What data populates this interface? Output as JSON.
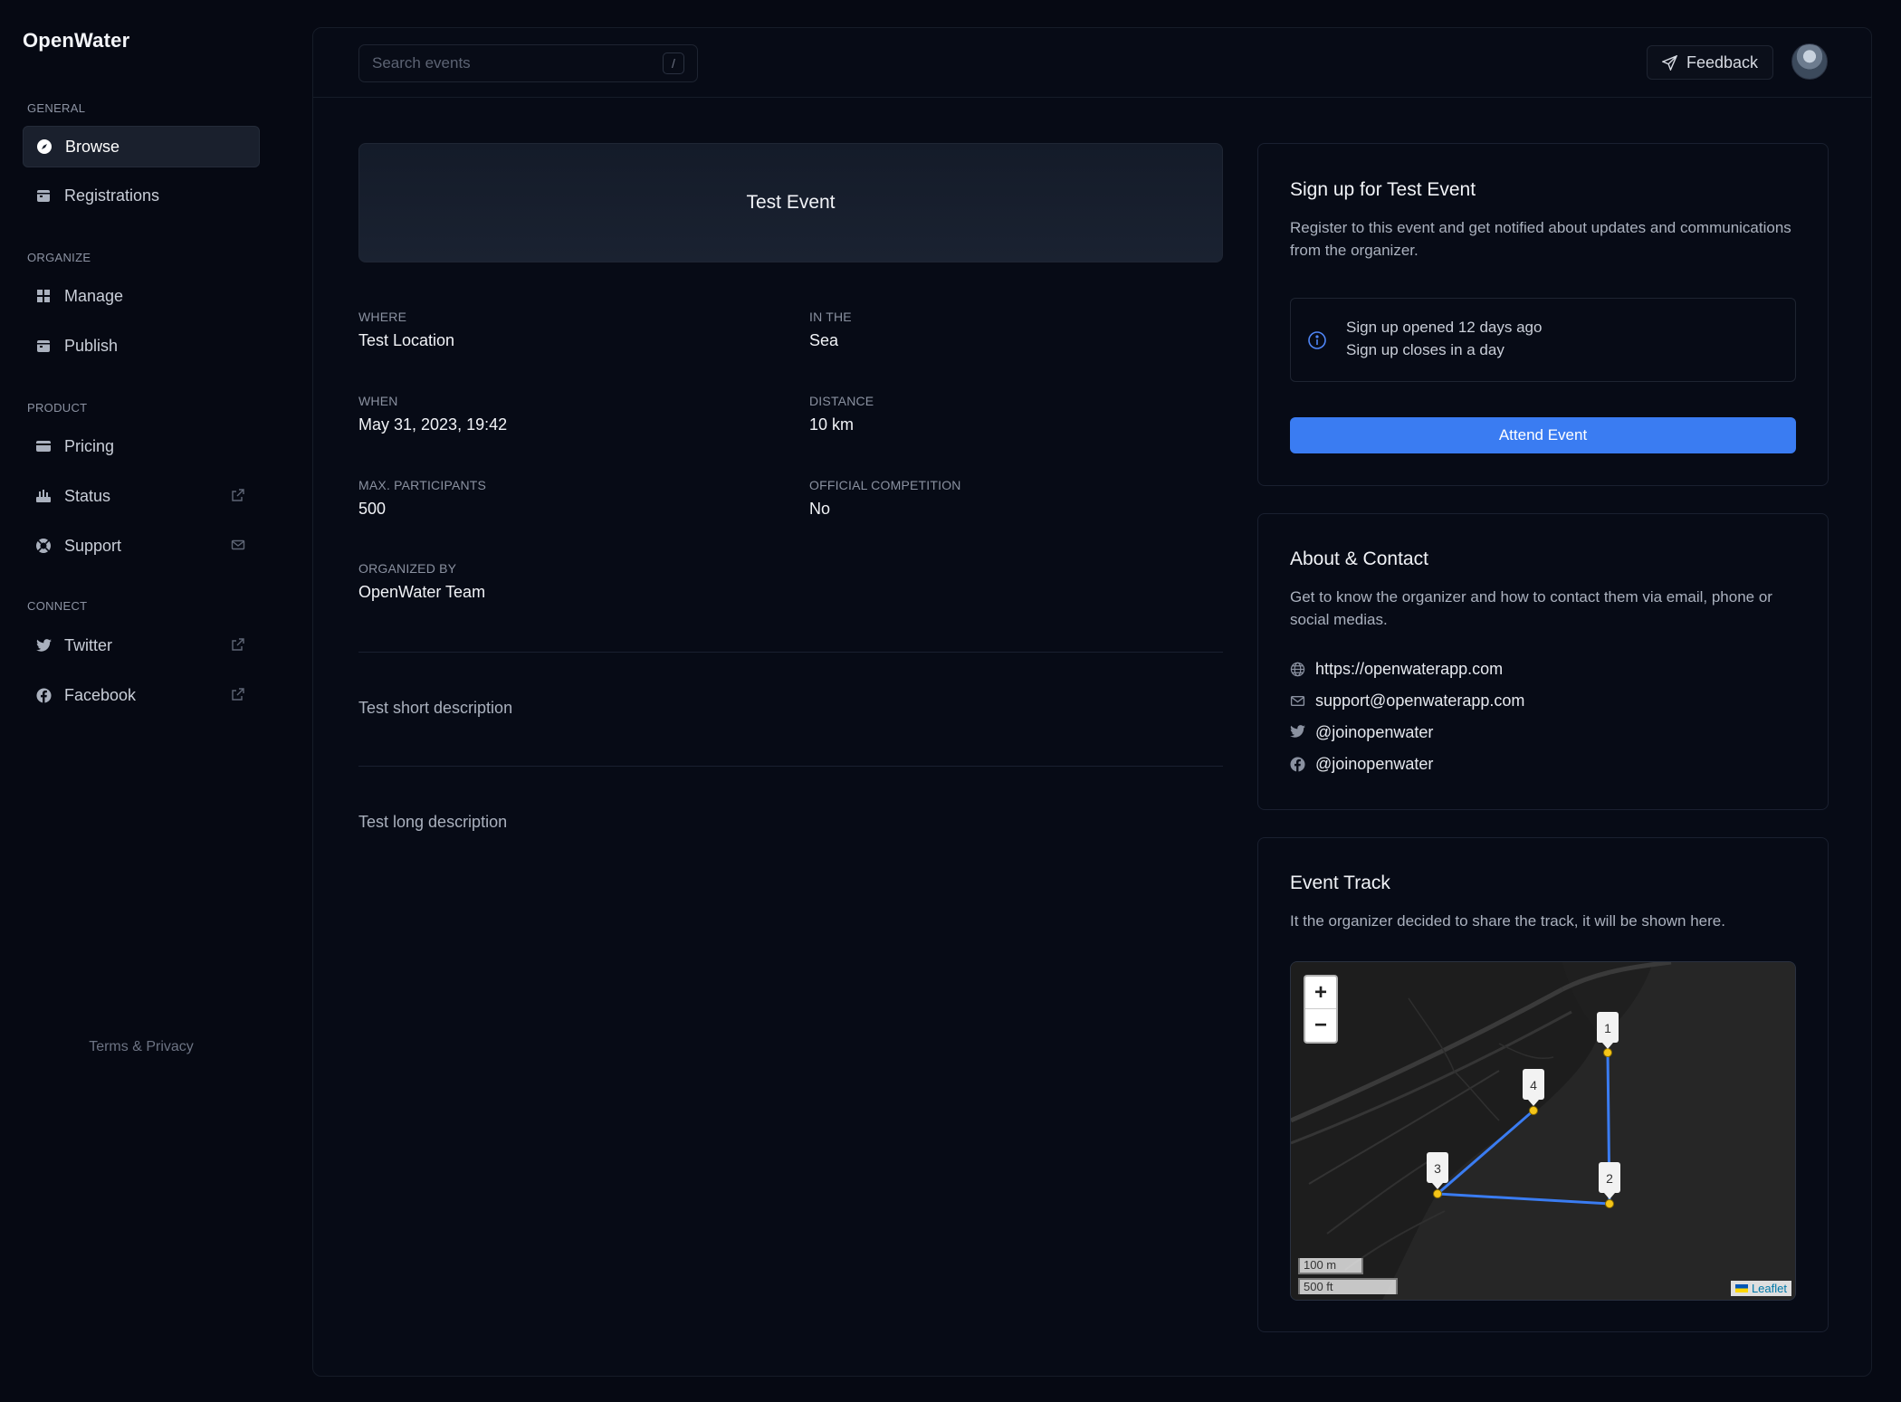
{
  "app": {
    "name": "OpenWater"
  },
  "sidebar": {
    "sections": [
      {
        "label": "GENERAL"
      },
      {
        "label": "ORGANIZE"
      },
      {
        "label": "PRODUCT"
      },
      {
        "label": "CONNECT"
      }
    ],
    "items": [
      {
        "label": "Browse",
        "icon": "compass-icon"
      },
      {
        "label": "Registrations",
        "icon": "calendar-icon"
      },
      {
        "label": "Manage",
        "icon": "grid-icon"
      },
      {
        "label": "Publish",
        "icon": "calendar-icon"
      },
      {
        "label": "Pricing",
        "icon": "credit-card-icon"
      },
      {
        "label": "Status",
        "icon": "status-icon",
        "trail": "external-link-icon"
      },
      {
        "label": "Support",
        "icon": "lifebuoy-icon",
        "trail": "mail-icon"
      },
      {
        "label": "Twitter",
        "icon": "twitter-icon",
        "trail": "external-link-icon"
      },
      {
        "label": "Facebook",
        "icon": "facebook-icon",
        "trail": "external-link-icon"
      }
    ],
    "footer": "Terms & Privacy"
  },
  "topbar": {
    "search_placeholder": "Search events",
    "search_shortcut": "/",
    "feedback_label": "Feedback"
  },
  "event": {
    "title": "Test Event",
    "fields": [
      {
        "label": "WHERE",
        "value": "Test Location"
      },
      {
        "label": "IN THE",
        "value": "Sea"
      },
      {
        "label": "WHEN",
        "value": "May 31, 2023, 19:42"
      },
      {
        "label": "DISTANCE",
        "value": "10 km"
      },
      {
        "label": "MAX. PARTICIPANTS",
        "value": "500"
      },
      {
        "label": "OFFICIAL COMPETITION",
        "value": "No"
      },
      {
        "label": "ORGANIZED BY",
        "value": "OpenWater Team"
      }
    ],
    "short_description": "Test short description",
    "long_description": "Test long description"
  },
  "signup": {
    "title": "Sign up for Test Event",
    "subtitle": "Register to this event and get notified about updates and communications from the organizer.",
    "opened": "Sign up opened 12 days ago",
    "closes": "Sign up closes in a day",
    "button": "Attend Event"
  },
  "about": {
    "title": "About & Contact",
    "subtitle": "Get to know the organizer and how to contact them via email, phone or social medias.",
    "website": "https://openwaterapp.com",
    "email": "support@openwaterapp.com",
    "twitter": "@joinopenwater",
    "facebook": "@joinopenwater"
  },
  "track": {
    "title": "Event Track",
    "subtitle": "It the organizer decided to share the track, it will be shown here.",
    "markers": [
      "1",
      "2",
      "3",
      "4"
    ],
    "zoom_in": "+",
    "zoom_out": "−",
    "scale_metric": "100 m",
    "scale_imperial": "500 ft",
    "attribution": "Leaflet"
  },
  "colors": {
    "accent": "#3a7cf2",
    "background": "#060913",
    "track_line": "#3a7cf2",
    "marker_dot": "#f5c518"
  }
}
